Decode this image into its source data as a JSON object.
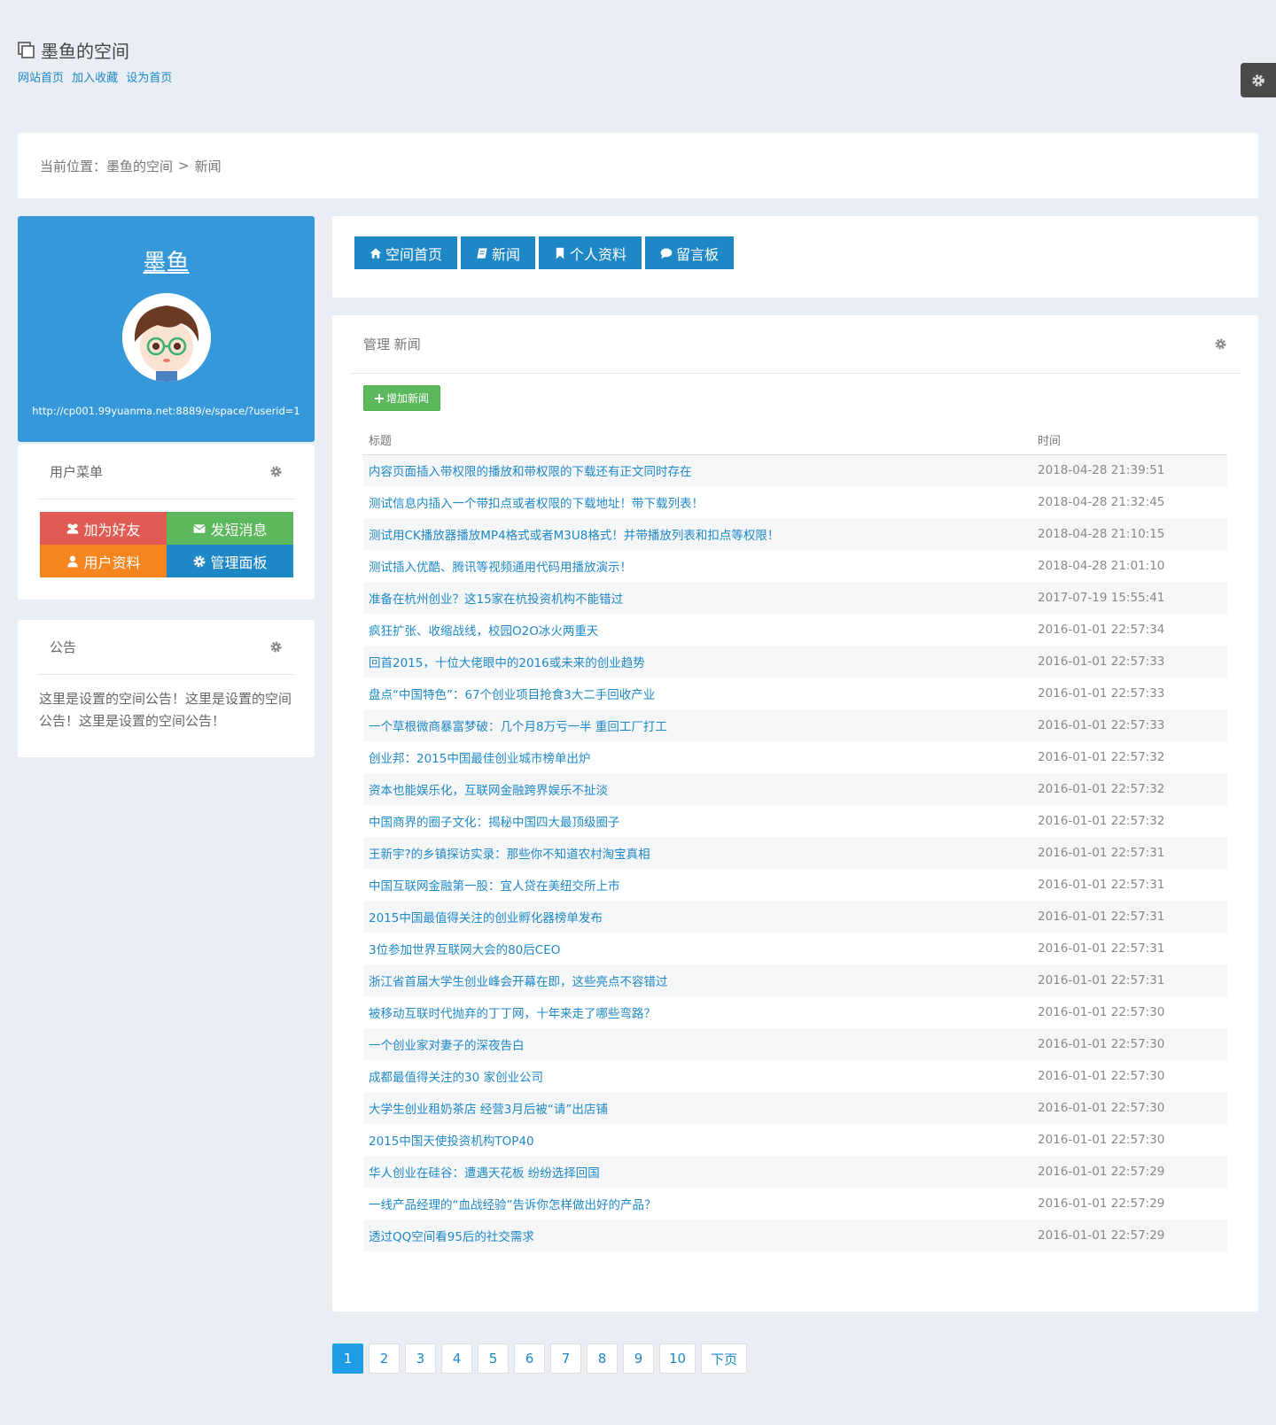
{
  "header": {
    "title": "墨鱼的空间",
    "links": [
      "网站首页",
      "加入收藏",
      "设为首页"
    ]
  },
  "breadcrumb": {
    "prefix": "当前位置：",
    "space": "墨鱼的空间",
    "separator": ">",
    "current": "新闻"
  },
  "profile": {
    "name": "墨鱼",
    "url": "http://cp001.99yuanma.net:8889/e/space/?userid=1"
  },
  "user_menu": {
    "title": "用户菜单",
    "buttons": [
      "加为好友",
      "发短消息",
      "用户资料",
      "管理面板"
    ]
  },
  "notice": {
    "title": "公告",
    "text": "这里是设置的空间公告！这里是设置的空间公告！这里是设置的空间公告！"
  },
  "tabs": [
    "空间首页",
    "新闻",
    "个人资料",
    "留言板"
  ],
  "main": {
    "title": "管理 新闻",
    "add_button": "增加新闻",
    "columns": [
      "标题",
      "时间"
    ],
    "rows": [
      {
        "title": "内容页面插入带权限的播放和带权限的下载还有正文同时存在",
        "time": "2018-04-28 21:39:51"
      },
      {
        "title": "测试信息内插入一个带扣点或者权限的下载地址！带下载列表！",
        "time": "2018-04-28 21:32:45"
      },
      {
        "title": "测试用CK播放器播放MP4格式或者M3U8格式！并带播放列表和扣点等权限！",
        "time": "2018-04-28 21:10:15"
      },
      {
        "title": "测试插入优酷、腾讯等视频通用代码用播放演示！",
        "time": "2018-04-28 21:01:10"
      },
      {
        "title": "准备在杭州创业？这15家在杭投资机构不能错过",
        "time": "2017-07-19 15:55:41"
      },
      {
        "title": "疯狂扩张、收缩战线，校园O2O冰火两重天",
        "time": "2016-01-01 22:57:34"
      },
      {
        "title": "回首2015，十位大佬眼中的2016或未来的创业趋势",
        "time": "2016-01-01 22:57:33"
      },
      {
        "title": "盘点“中国特色”：67个创业项目抢食3大二手回收产业",
        "time": "2016-01-01 22:57:33"
      },
      {
        "title": "一个草根微商暴富梦破：几个月8万亏一半 重回工厂打工",
        "time": "2016-01-01 22:57:33"
      },
      {
        "title": "创业邦：2015中国最佳创业城市榜单出炉",
        "time": "2016-01-01 22:57:32"
      },
      {
        "title": "资本也能娱乐化，互联网金融跨界娱乐不扯淡",
        "time": "2016-01-01 22:57:32"
      },
      {
        "title": "中国商界的圈子文化：揭秘中国四大最顶级圈子",
        "time": "2016-01-01 22:57:32"
      },
      {
        "title": "王新宇?的乡镇探访实录：那些你不知道农村淘宝真相",
        "time": "2016-01-01 22:57:31"
      },
      {
        "title": "中国互联网金融第一股：宜人贷在美纽交所上市",
        "time": "2016-01-01 22:57:31"
      },
      {
        "title": "2015中国最值得关注的创业孵化器榜单发布",
        "time": "2016-01-01 22:57:31"
      },
      {
        "title": "3位参加世界互联网大会的80后CEO",
        "time": "2016-01-01 22:57:31"
      },
      {
        "title": "浙江省首届大学生创业峰会开幕在即，这些亮点不容错过",
        "time": "2016-01-01 22:57:31"
      },
      {
        "title": "被移动互联时代抛弃的丁丁网，十年来走了哪些弯路？",
        "time": "2016-01-01 22:57:30"
      },
      {
        "title": "一个创业家对妻子的深夜告白",
        "time": "2016-01-01 22:57:30"
      },
      {
        "title": "成都最值得关注的30 家创业公司",
        "time": "2016-01-01 22:57:30"
      },
      {
        "title": "大学生创业租奶茶店 经营3月后被“请”出店铺",
        "time": "2016-01-01 22:57:30"
      },
      {
        "title": "2015中国天使投资机构TOP40",
        "time": "2016-01-01 22:57:30"
      },
      {
        "title": "华人创业在硅谷：遭遇天花板 纷纷选择回国",
        "time": "2016-01-01 22:57:29"
      },
      {
        "title": "一线产品经理的“血战经验”告诉你怎样做出好的产品？",
        "time": "2016-01-01 22:57:29"
      },
      {
        "title": "透过QQ空间看95后的社交需求",
        "time": "2016-01-01 22:57:29"
      }
    ]
  },
  "pagination": {
    "pages": [
      "1",
      "2",
      "3",
      "4",
      "5",
      "6",
      "7",
      "8",
      "9",
      "10"
    ],
    "next": "下页",
    "current": "1"
  }
}
